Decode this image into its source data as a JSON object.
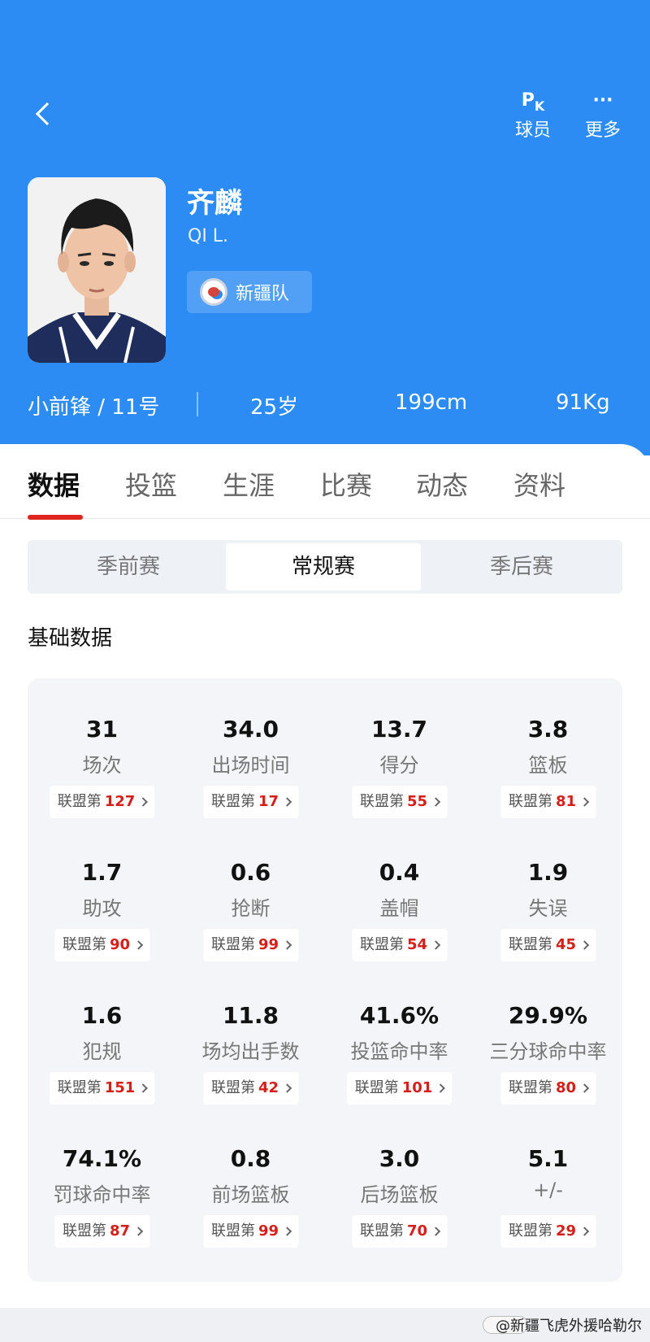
{
  "header": {
    "actions": [
      {
        "icon": "pk-icon",
        "icon_text": "P",
        "icon_sub": "K",
        "label": "球员"
      },
      {
        "icon": "more-icon",
        "icon_text": "···",
        "label": "更多"
      }
    ]
  },
  "player": {
    "name_cn": "齐麟",
    "name_en": "QI L.",
    "team": "新疆队",
    "position_number": "小前锋 / 11号",
    "age": "25岁",
    "height": "199cm",
    "weight": "91Kg"
  },
  "tabs": [
    "数据",
    "投篮",
    "生涯",
    "比赛",
    "动态",
    "资料"
  ],
  "season_types": [
    "季前赛",
    "常规赛",
    "季后赛"
  ],
  "section_title": "基础数据",
  "rank_prefix": "联盟第",
  "stats": [
    {
      "value": "31",
      "label": "场次",
      "rank": "127"
    },
    {
      "value": "34.0",
      "label": "出场时间",
      "rank": "17"
    },
    {
      "value": "13.7",
      "label": "得分",
      "rank": "55"
    },
    {
      "value": "3.8",
      "label": "篮板",
      "rank": "81"
    },
    {
      "value": "1.7",
      "label": "助攻",
      "rank": "90"
    },
    {
      "value": "0.6",
      "label": "抢断",
      "rank": "99"
    },
    {
      "value": "0.4",
      "label": "盖帽",
      "rank": "54"
    },
    {
      "value": "1.9",
      "label": "失误",
      "rank": "45"
    },
    {
      "value": "1.6",
      "label": "犯规",
      "rank": "151"
    },
    {
      "value": "11.8",
      "label": "场均出手数",
      "rank": "42"
    },
    {
      "value": "41.6%",
      "label": "投篮命中率",
      "rank": "101"
    },
    {
      "value": "29.9%",
      "label": "三分球命中率",
      "rank": "80"
    },
    {
      "value": "74.1%",
      "label": "罚球命中率",
      "rank": "87"
    },
    {
      "value": "0.8",
      "label": "前场篮板",
      "rank": "99"
    },
    {
      "value": "3.0",
      "label": "后场篮板",
      "rank": "70"
    },
    {
      "value": "5.1",
      "label": "+/-",
      "rank": "29"
    }
  ],
  "watermark": "@新疆飞虎外援哈勒尔",
  "colors": {
    "header_blue": "#2c8cf4",
    "accent_red": "#e0251f",
    "rank_red": "#d3201b"
  }
}
